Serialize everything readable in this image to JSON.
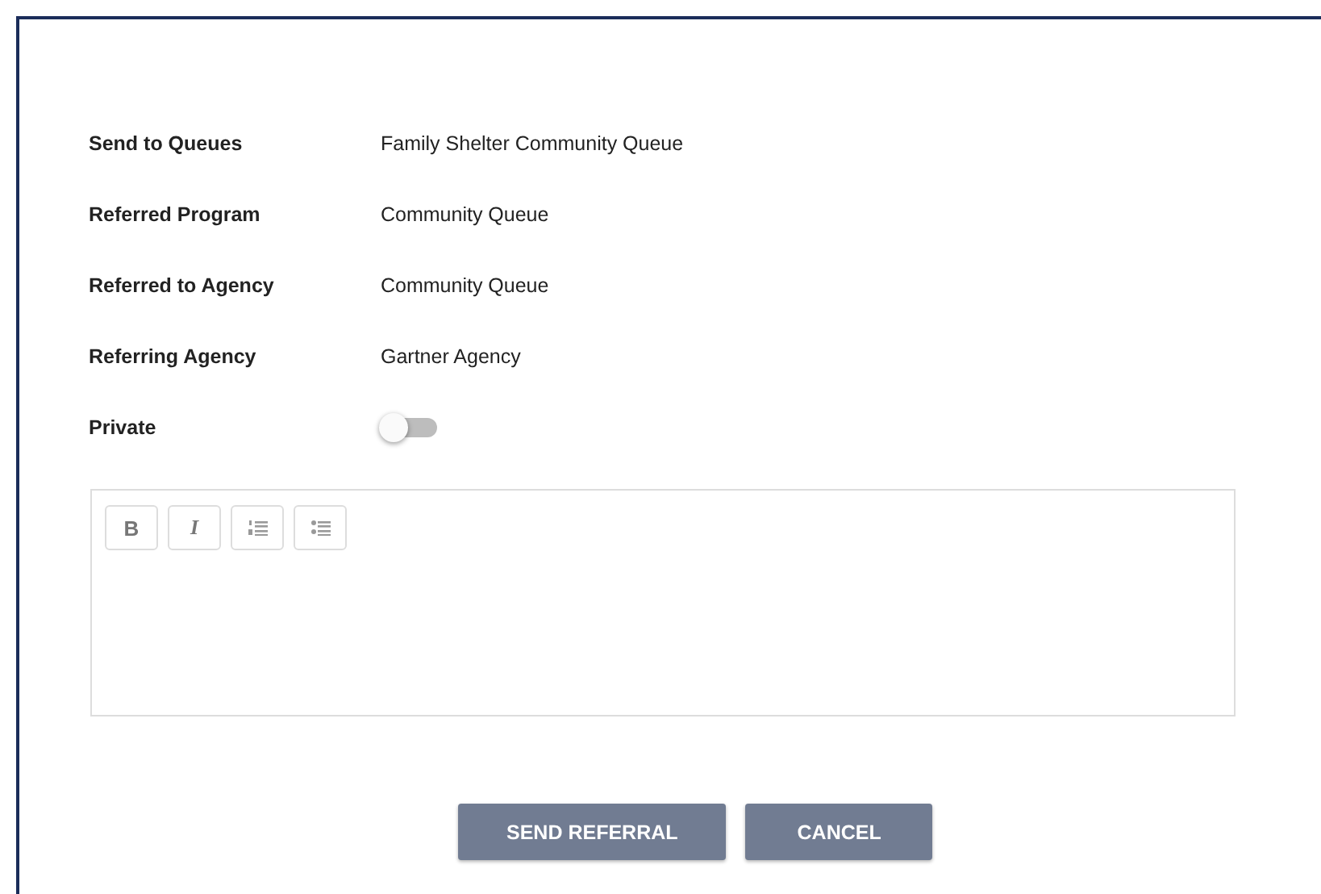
{
  "fields": [
    {
      "label": "Send to Queues",
      "value": "Family Shelter Community Queue"
    },
    {
      "label": "Referred Program",
      "value": "Community Queue"
    },
    {
      "label": "Referred to Agency",
      "value": "Community Queue"
    },
    {
      "label": "Referring Agency",
      "value": "Gartner Agency"
    }
  ],
  "private": {
    "label": "Private",
    "on": false
  },
  "editor": {
    "toolbar": [
      {
        "kind": "bold",
        "label": "B"
      },
      {
        "kind": "italic",
        "label": "I"
      },
      {
        "kind": "ordered-list"
      },
      {
        "kind": "bullet-list"
      }
    ]
  },
  "buttons": [
    "SEND REFERRAL",
    "CANCEL"
  ]
}
